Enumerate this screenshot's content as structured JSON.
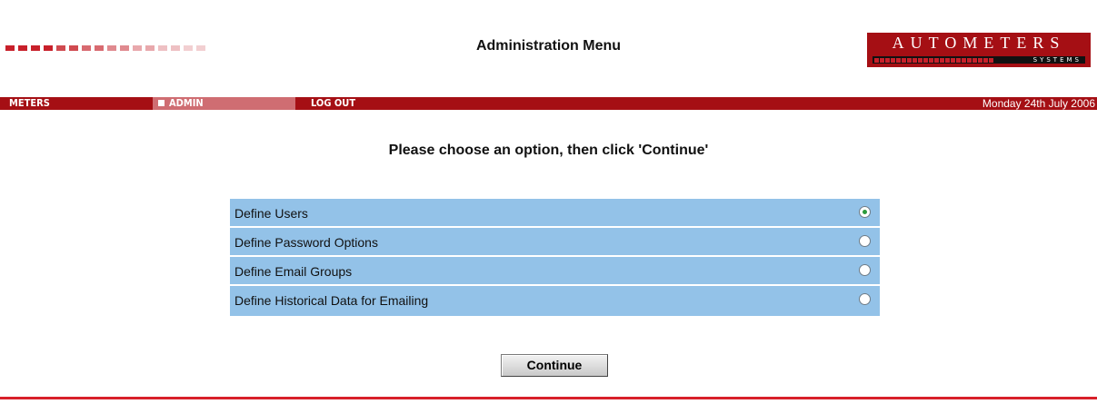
{
  "header": {
    "title": "Administration Menu",
    "decor_colors": [
      "#c8202a",
      "#c8202a",
      "#c8202a",
      "#c8202a",
      "#d04a50",
      "#d04a50",
      "#d86a70",
      "#d86a70",
      "#e08a8f",
      "#e08a8f",
      "#e8a8ac",
      "#e8a8ac",
      "#eec0c3",
      "#eec0c3",
      "#f2cfd1",
      "#f2cfd1"
    ]
  },
  "logo": {
    "word": "AUTOMETERS",
    "sub": "SYSTEMS",
    "color": "#a50f14"
  },
  "nav": {
    "meters": "METERS",
    "admin": "ADMIN",
    "logout": "LOG OUT",
    "date": "Monday 24th July 2006",
    "active": "ADMIN",
    "bar_color": "#a50f14"
  },
  "main": {
    "instruction": "Please choose an option, then click 'Continue'",
    "options": [
      {
        "label": "Define Users",
        "selected": true
      },
      {
        "label": "Define Password Options",
        "selected": false
      },
      {
        "label": "Define Email Groups",
        "selected": false
      },
      {
        "label": "Define Historical Data for Emailing",
        "selected": false
      }
    ],
    "continue_label": "Continue",
    "row_color": "#93c2e8"
  }
}
